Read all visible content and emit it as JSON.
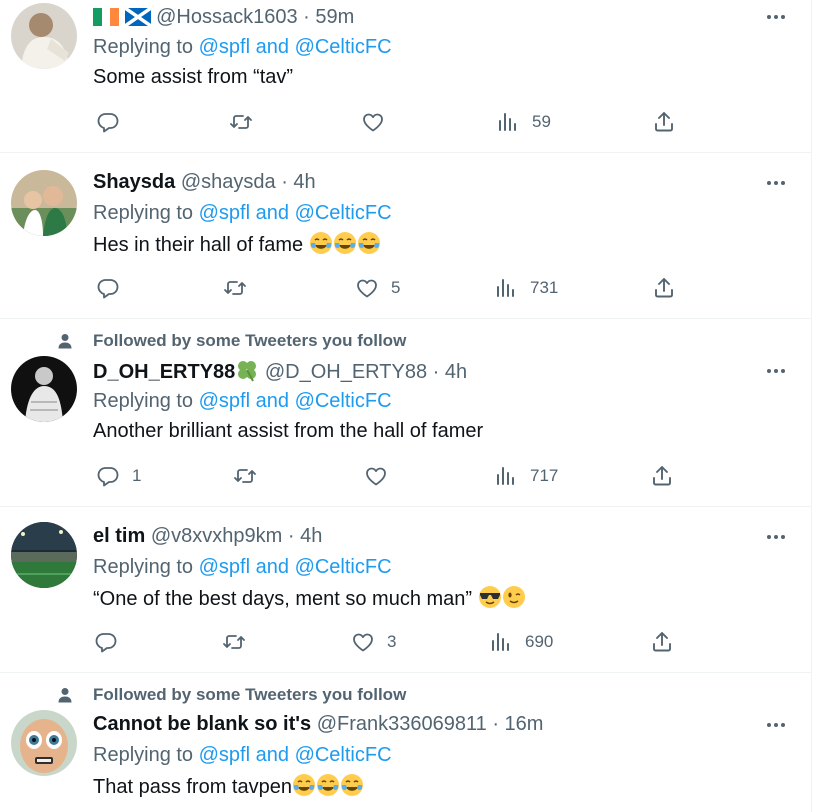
{
  "colors": {
    "link": "#1d9bf0",
    "muted": "#536471",
    "text": "#0f1419",
    "border": "#eff3f4"
  },
  "social_context": "Followed by some Tweeters you follow",
  "reply_prefix": "Replying to",
  "reply_joiner": "and",
  "tweets": [
    {
      "name": "",
      "flags": [
        "ireland-flag-emoji",
        "scotland-flag-emoji"
      ],
      "handle": "@Hossack1603",
      "dot": "·",
      "time": "59m",
      "reply_to": [
        "@spfl",
        "@CelticFC"
      ],
      "text": "Some assist from “tav”",
      "emoji": [],
      "replies": "",
      "likes": "",
      "views": "59"
    },
    {
      "name": "Shaysda",
      "handle": "@shaysda",
      "dot": "·",
      "time": "4h",
      "reply_to": [
        "@spfl",
        "@CelticFC"
      ],
      "text": "Hes in their hall of fame ",
      "emoji": [
        "face-with-tears-of-joy-emoji",
        "face-with-tears-of-joy-emoji",
        "face-with-tears-of-joy-emoji"
      ],
      "replies": "",
      "likes": "5",
      "views": "731"
    },
    {
      "followed": true,
      "name": "D_OH_ERTY88",
      "name_emoji": "four-leaf-clover-emoji",
      "handle": "@D_OH_ERTY88",
      "dot": "·",
      "time": "4h",
      "reply_to": [
        "@spfl",
        "@CelticFC"
      ],
      "text": "Another brilliant assist from the hall of famer",
      "emoji": [],
      "replies": "1",
      "likes": "",
      "views": "717"
    },
    {
      "name": "el tim",
      "handle": "@v8xvxhp9km",
      "dot": "·",
      "time": "4h",
      "reply_to": [
        "@spfl",
        "@CelticFC"
      ],
      "text": "“One of the best days, ment so much man” ",
      "emoji": [
        "smiling-face-with-sunglasses-emoji",
        "winking-face-emoji"
      ],
      "replies": "",
      "likes": "3",
      "views": "690"
    },
    {
      "followed": true,
      "name": "Cannot be blank so it's",
      "handle": "@Frank336069811",
      "dot": "·",
      "time": "16m",
      "reply_to": [
        "@spfl",
        "@CelticFC"
      ],
      "text": "That pass from tavpen",
      "emoji": [
        "face-with-tears-of-joy-emoji",
        "face-with-tears-of-joy-emoji",
        "face-with-tears-of-joy-emoji"
      ],
      "replies": "",
      "likes": "",
      "views": ""
    }
  ]
}
